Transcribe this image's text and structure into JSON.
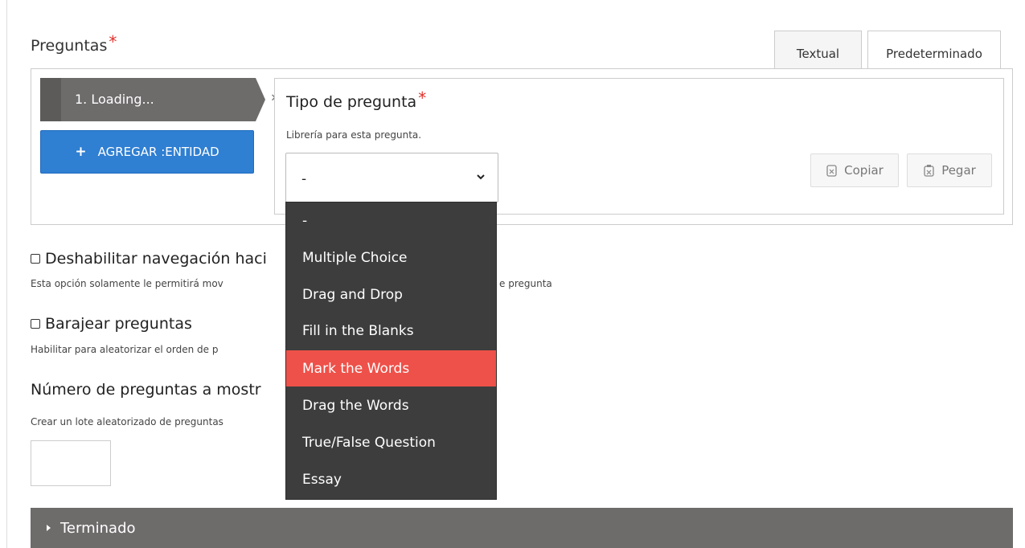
{
  "header": {
    "title": "Preguntas",
    "required_mark": "*"
  },
  "tabs": [
    {
      "label": "Textual"
    },
    {
      "label": "Predeterminado",
      "active": true
    }
  ],
  "list": {
    "item_label": "1. Loading...",
    "add_button_label": "AGREGAR :ENTIDAD",
    "add_button_icon": "plus-icon",
    "remove_icon": "close-circle-icon"
  },
  "editor": {
    "field_label": "Tipo de pregunta",
    "required_mark": "*",
    "field_description": "Librería para esta pregunta.",
    "select_value": "-",
    "copy_label": "Copiar",
    "paste_label": "Pegar"
  },
  "dropdown": {
    "options": [
      "-",
      "Multiple Choice",
      "Drag and Drop",
      "Fill in the Blanks",
      "Mark the Words",
      "Drag the Words",
      "True/False Question",
      "Essay"
    ],
    "highlighted": "Mark the Words",
    "highlight_color": "#ee5149"
  },
  "options": {
    "disable_nav_label": "Deshabilitar navegación haci",
    "disable_nav_desc_left": "Esta opción solamente le permitirá mov",
    "disable_nav_desc_right": "e pregunta",
    "shuffle_label": "Barajear preguntas",
    "shuffle_desc": "Habilitar para aleatorizar el orden de p",
    "num_questions_label": "Número de preguntas a mostr",
    "num_questions_desc": "Crear un lote aleatorizado de preguntas"
  },
  "footer": {
    "collapsed_section_label": "Terminado"
  },
  "colors": {
    "accent_blue": "#2f7fd2",
    "dark_gray": "#6e6b6b",
    "dropdown_bg": "#3d3d3d",
    "required_red": "#e0302b"
  }
}
